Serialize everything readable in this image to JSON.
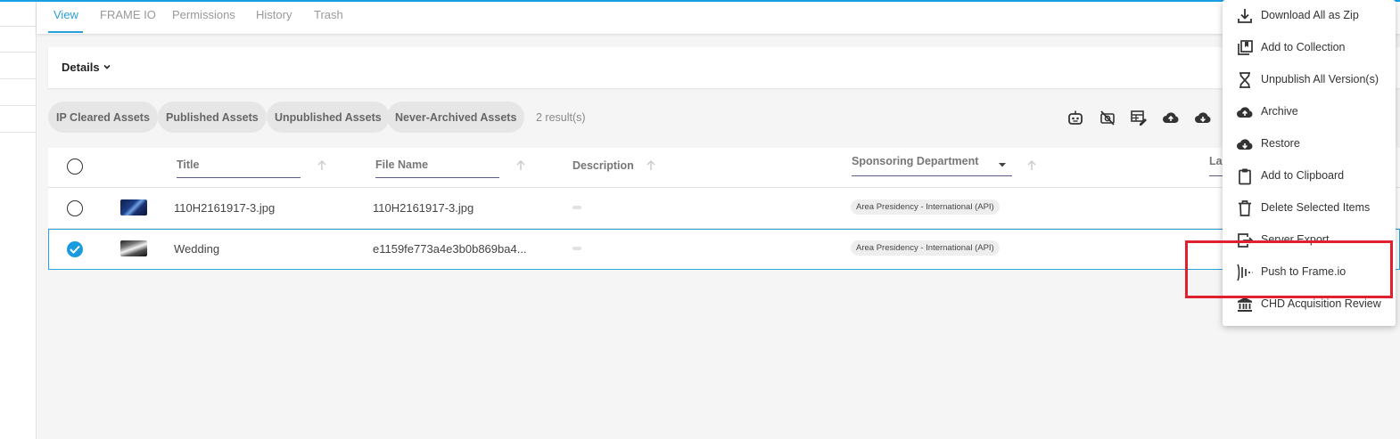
{
  "tabs": [
    "View",
    "FRAME IO",
    "Permissions",
    "History",
    "Trash"
  ],
  "details": {
    "label": "Details"
  },
  "chips": [
    "IP Cleared Assets",
    "Published Assets",
    "Unpublished Assets",
    "Never-Archived Assets"
  ],
  "results": "2 result(s)",
  "toolbar_icons": [
    "robot-icon",
    "no-camera-icon",
    "table-edit-icon",
    "cloud-upload-icon",
    "cloud-download-icon"
  ],
  "columns": {
    "title": "Title",
    "file_name": "File Name",
    "description": "Description",
    "sponsoring_department": "Sponsoring Department",
    "last": "La"
  },
  "rows": [
    {
      "title": "110H2161917-3.jpg",
      "file_name": "110H2161917-3.jpg",
      "department": "Area Presidency - International (API)",
      "selected": false
    },
    {
      "title": "Wedding",
      "file_name": "e1159fe773a4e3b0b869ba4...",
      "department": "Area Presidency - International (API)",
      "selected": true
    }
  ],
  "menu": [
    {
      "label": "Download All as Zip",
      "icon": "download-icon"
    },
    {
      "label": "Add to Collection",
      "icon": "collection-icon"
    },
    {
      "label": "Unpublish All Version(s)",
      "icon": "hourglass-icon"
    },
    {
      "label": "Archive",
      "icon": "cloud-upload-icon"
    },
    {
      "label": "Restore",
      "icon": "cloud-download-icon"
    },
    {
      "label": "Add to Clipboard",
      "icon": "clipboard-icon"
    },
    {
      "label": "Delete Selected Items",
      "icon": "trash-icon"
    },
    {
      "label": "Server Export",
      "icon": "export-icon"
    },
    {
      "label": "Push to Frame.io",
      "icon": "frameio-icon"
    },
    {
      "label": "CHD Acquisition Review",
      "icon": "bank-icon"
    }
  ],
  "colors": {
    "accent": "#2a9fd8",
    "highlight": "#e0202e",
    "selected_row": "#2aa4dc"
  }
}
